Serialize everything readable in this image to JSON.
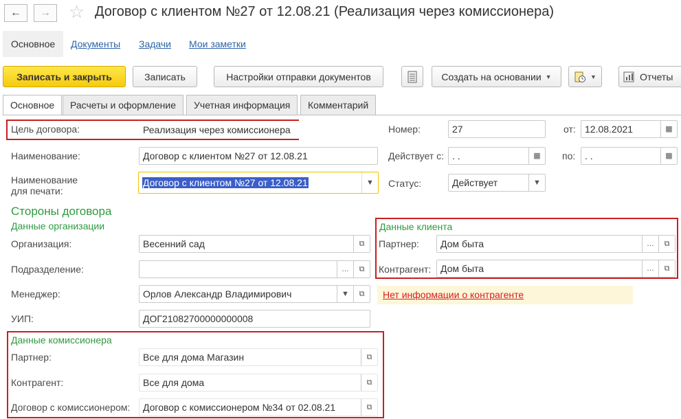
{
  "window": {
    "title": "Договор с клиентом №27 от 12.08.21 (Реализация через комиссионера)",
    "back_icon": "arrow-left-icon",
    "forward_icon": "arrow-right-icon",
    "star_icon": "star-icon"
  },
  "nav": {
    "main": "Основное",
    "documents": "Документы",
    "tasks": "Задачи",
    "notes": "Мои заметки"
  },
  "toolbar": {
    "save_close": "Записать и закрыть",
    "save": "Записать",
    "send_settings": "Настройки отправки документов",
    "create_based": "Создать на основании",
    "reports": "Отчеты"
  },
  "tabs": [
    "Основное",
    "Расчеты и оформление",
    "Учетная информация",
    "Комментарий"
  ],
  "form": {
    "purpose_label": "Цель договора:",
    "purpose_value": "Реализация через комиссионера",
    "number_label": "Номер:",
    "number_value": "27",
    "from_label": "от:",
    "from_value": "12.08.2021",
    "name_label": "Наименование:",
    "name_value": "Договор с клиентом №27 от 12.08.21",
    "valid_label": "Действует с:",
    "valid_value": " .  .",
    "to_label": "по:",
    "to_value": " .  .",
    "print_label_1": "Наименование",
    "print_label_2": "для печати:",
    "print_value": "Договор с клиентом №27 от 12.08.21",
    "status_label": "Статус:",
    "status_value": "Действует"
  },
  "sides": {
    "heading": "Стороны договора",
    "org_section": "Данные организации",
    "org_label": "Организация:",
    "org_value": "Весенний сад",
    "dept_label": "Подразделение:",
    "dept_value": "",
    "manager_label": "Менеджер:",
    "manager_value": "Орлов Александр Владимирович",
    "uip_label": "УИП:",
    "uip_value": "ДОГ21082700000000008",
    "client_section": "Данные клиента",
    "partner_label": "Партнер:",
    "partner_value": "Дом быта",
    "contractor_label": "Контрагент:",
    "contractor_value": "Дом быта",
    "no_info_link": "Нет информации о контрагенте",
    "agent_section": "Данные комиссионера",
    "agent_partner_label": "Партнер:",
    "agent_partner_value": "Все для дома Магазин",
    "agent_contractor_label": "Контрагент:",
    "agent_contractor_value": "Все для дома",
    "agent_contract_label": "Договор с комиссионером:",
    "agent_contract_value": "Договор с комиссионером №34 от 02.08.21"
  },
  "colors": {
    "primary_button": "#f5cb0c",
    "section_green": "#2e9a3f",
    "highlight_red": "#c81e1e",
    "link_blue": "#2c64a8",
    "selection": "#3b5fc8"
  }
}
